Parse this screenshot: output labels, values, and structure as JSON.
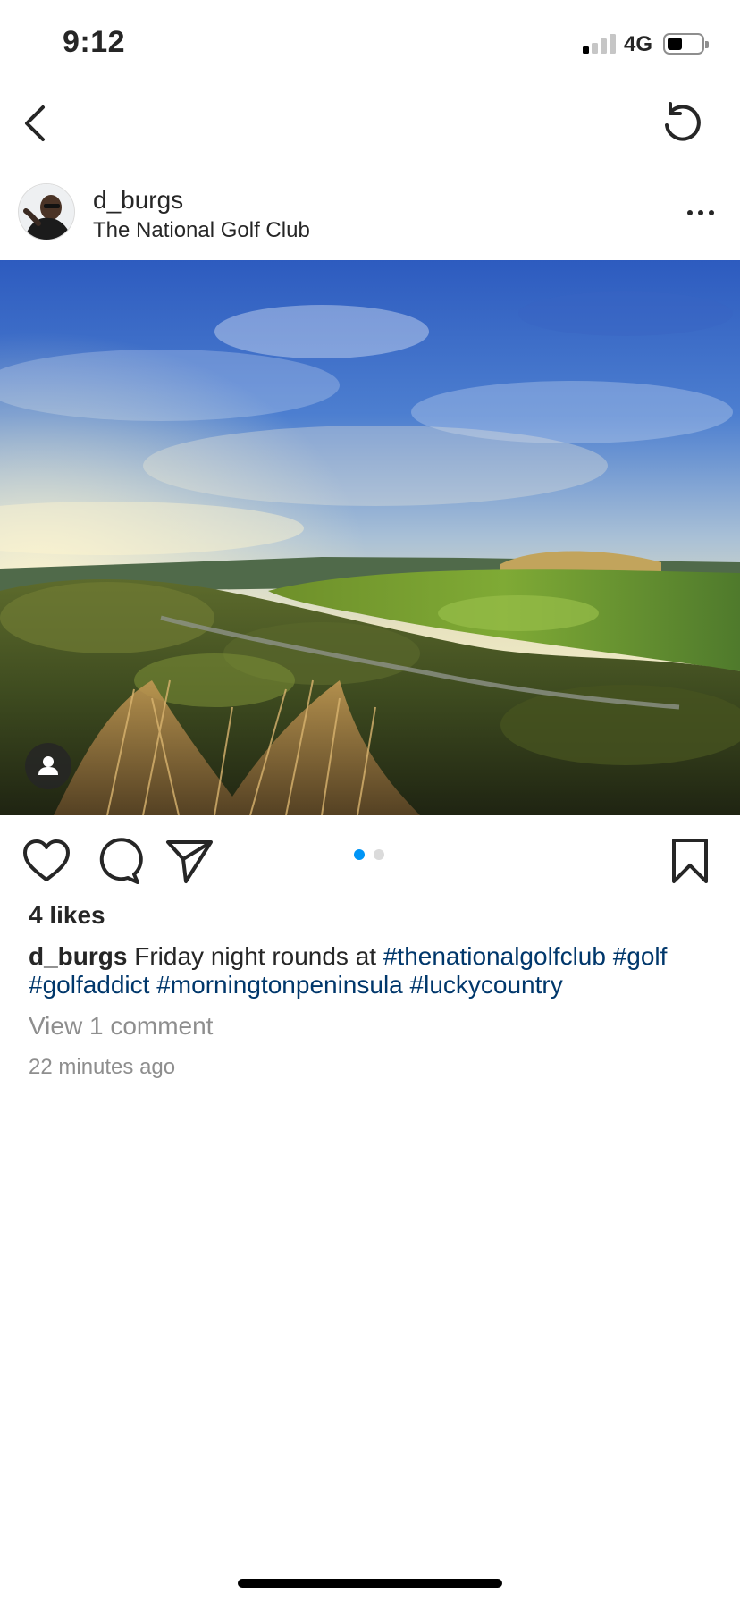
{
  "status_bar": {
    "time": "9:12",
    "network": "4G",
    "signal_bars_active": 1,
    "signal_bars_total": 4,
    "battery_level": 0.45
  },
  "nav": {
    "back_icon": "chevron-left-icon",
    "refresh_icon": "refresh-icon"
  },
  "post": {
    "username": "d_burgs",
    "location": "The National Golf Club",
    "more_icon": "more-horizontal-icon",
    "carousel": {
      "current_index": 1,
      "total": 2,
      "active_color": "#0095f6",
      "inactive_color": "#dbdbdb"
    },
    "likes": "4 likes",
    "caption": {
      "username": "d_burgs",
      "text": "Friday night rounds at",
      "tags": [
        "#thenationalgolfclub",
        "#golf",
        "#golfaddict",
        "#morningtonpeninsula",
        "#luckycountry"
      ]
    },
    "view_comments": "View 1 comment",
    "timestamp": "22 minutes ago"
  },
  "colors": {
    "text": "#262626",
    "secondary_text": "#8e8e8e",
    "hashtag": "#00376b",
    "divider": "#dbdbdb"
  }
}
